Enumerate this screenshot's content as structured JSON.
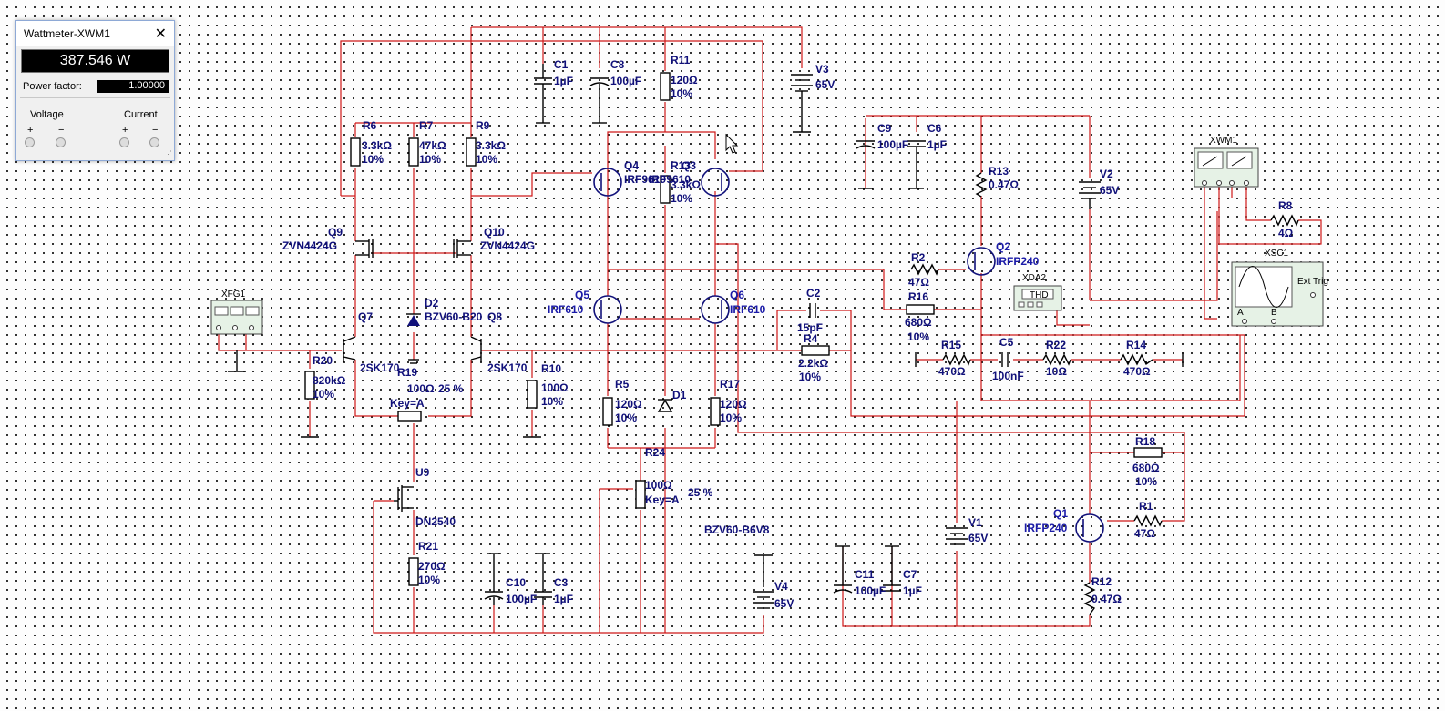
{
  "wattmeter_window": {
    "title": "Wattmeter-XWM1",
    "reading": "387.546 W",
    "power_factor_label": "Power factor:",
    "power_factor_value": "1.00000",
    "voltage_label": "Voltage",
    "current_label": "Current",
    "plus": "+",
    "minus": "−"
  },
  "labels": {
    "c1": "C1",
    "c1_val": "1µF",
    "c8": "C8",
    "c8_val": "100µF",
    "r11": "R11",
    "r11_val": "120Ω",
    "r11_tol": "10%",
    "v3": "V3",
    "v3_val": "65V",
    "r6": "R6",
    "r6_val": "3.3kΩ",
    "r6_tol": "10%",
    "r7": "R7",
    "r7_val": "47kΩ",
    "r7_tol": "10%",
    "r9": "R9",
    "r9_val": "3.3kΩ",
    "r9_tol": "10%",
    "q4": "Q4",
    "q4_part": "IRF9610",
    "r13top": "R13",
    "r13top_val": "3.3kΩ",
    "r13top_tol": "10%",
    "q3": "Q3",
    "q3_part": "IRF9610",
    "c9": "C9",
    "c9_val": "100µF",
    "c6": "C6",
    "c6_val": "1µF",
    "r13": "R13",
    "r13_val": "0.47Ω",
    "v2": "V2",
    "v2_val": "65V",
    "xwm1": "XWM1",
    "r8": "R8",
    "r8_val": "4Ω",
    "xsc1": "XSC1",
    "q9": "Q9",
    "q9_part": "ZVN4424G",
    "q10": "Q10",
    "q10_part": "ZVN4424G",
    "r2": "R2",
    "r2_val": "47Ω",
    "q2": "Q2",
    "q2_part": "IRFP240",
    "xda2": "XDA2",
    "thd": "THD",
    "xfg1": "XFG1",
    "d2": "D2",
    "d2_part": "BZV60-B20",
    "q7": "Q7",
    "q8": "Q8",
    "q5": "Q5",
    "q5_part": "IRF610",
    "q6": "Q6",
    "q6_part": "IRF610",
    "c2": "C2",
    "c2_val": "15pF",
    "r16": "R16",
    "r16_val": "680Ω",
    "r16_tol": "10%",
    "r20": "R20",
    "r20_val": "820kΩ",
    "r20_tol": "10%",
    "q7_part": "2SK170",
    "q8_part": "2SK170",
    "r19": "R19",
    "r19_val": "100Ω",
    "r19_key": "Key=A",
    "r19_pct": "25 %",
    "r10": "R10",
    "r10_val": "100Ω",
    "r10_tol": "10%",
    "r4": "R4",
    "r4_val": "2.2kΩ",
    "r4_tol": "10%",
    "r15": "R15",
    "r15_val": "470Ω",
    "c5": "C5",
    "c5_val": "100nF",
    "r22": "R22",
    "r22_val": "10Ω",
    "r14": "R14",
    "r14_val": "470Ω",
    "r5": "R5",
    "r5_val": "120Ω",
    "r5_tol": "10%",
    "d1": "D1",
    "r17": "R17",
    "r17_val": "120Ω",
    "r17_tol": "10%",
    "r24": "R24",
    "r24_val": "100Ω",
    "r24_key": "Key=A",
    "r24_pct": "25 %",
    "r18": "R18",
    "r18_val": "680Ω",
    "r18_tol": "10%",
    "u9": "U9",
    "u9_part": "DN2540",
    "q1": "Q1",
    "q1_part": "IRFP240",
    "r1": "R1",
    "r1_val": "47Ω",
    "d1_part": "BZV60-B6V8",
    "v1": "V1",
    "v1_val": "65V",
    "r21": "R21",
    "r21_val": "270Ω",
    "r21_tol": "10%",
    "c10": "C10",
    "c10_val": "100µF",
    "c3": "C3",
    "c3_val": "1µF",
    "v4": "V4",
    "v4_val": "65V",
    "c11": "C11",
    "c11_val": "100µF",
    "c7": "C7",
    "c7_val": "1µF",
    "r12": "R12",
    "r12_val": "0.47Ω",
    "ext_trig": "Ext Trig",
    "ch_a": "A",
    "ch_b": "B"
  },
  "colors": {
    "wire": "#d01818",
    "label": "#10107a",
    "component": "#000000",
    "instrument_fill": "#e6f2e6",
    "background": "#fdfdfd"
  }
}
